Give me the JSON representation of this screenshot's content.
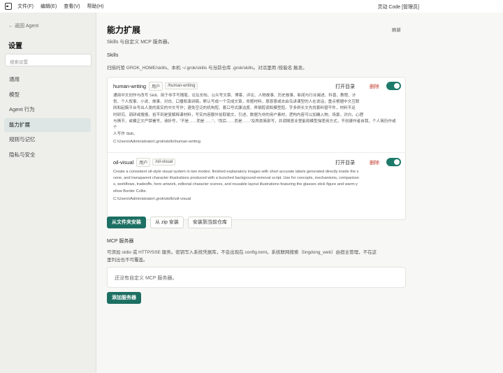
{
  "titlebar": {
    "menus": [
      "文件(F)",
      "编辑(E)",
      "查看(V)",
      "帮助(H)"
    ],
    "window_title": "灵动 Code [管理员]"
  },
  "sidebar": {
    "back": "← 返回 Agent",
    "title": "设置",
    "search_placeholder": "搜索设置",
    "items": [
      {
        "label": "通用",
        "active": false
      },
      {
        "label": "模型",
        "active": false
      },
      {
        "label": "Agent 行为",
        "active": false
      },
      {
        "label": "能力扩展",
        "active": true
      },
      {
        "label": "规则与记忆",
        "active": false
      },
      {
        "label": "隐私与安全",
        "active": false
      }
    ]
  },
  "main": {
    "title": "能力扩展",
    "refresh": "刷新",
    "subtitle": "Skills 与自定义 MCP 服务器。",
    "skills_heading": "Skills",
    "skills_desc": "扫描托管 GROK_HOME/skills、本机 ~/.grok/skills 与当前仓库 .grok/skills。对话里用 /技能名 触发。",
    "skills": [
      {
        "name": "human-writing",
        "tag_user": "用户",
        "tag_cmd": "/human-writing",
        "open": "打开目录",
        "delete": "删除",
        "enabled": true,
        "lines": [
          "通用中文创作与改写 Skill。用于非手写随笔、论坛长帖、公众号文章、博客、评论、人物故事、历史故事、新闻与行业阐述、科普、教程、计",
          "划、个人叙事、小说、故事、对白、口播和演讲稿，默认写成一个完成文章，命题材料，恩恩恩或去由鸟讲课型的人在说话，重点根据中文互联",
          "网和起稿平台写出人类的真实的中文写作；避免空泛的机构腔、套口号式廉洁度、弄钢腔调和模型腔。字多例长文先找套料替干件，材料不足",
          "时研究、调研或搜报，拾不到是复解释课材料，写实内容额外拾取输文，引述，数据为非的用户素材，逻构内容可以加确入物，场景，对白，心理",
          "与情节，或模正文严禁署号，请折号，“不是……而是……”，“而后……而是……”及两类简部写，并调随意业里能和模型描差用方式，不创建作者自我，个人简历作或个",
          "人写作 Skill。"
        ],
        "path": "C:\\Users\\Administrator\\.grok\\skills\\human-writing"
      },
      {
        "name": "oil-visual",
        "tag_user": "用户",
        "tag_cmd": "/oil-visual",
        "open": "打开目录",
        "delete": "删除",
        "enabled": true,
        "lines": [
          "Create a consistent oil-style visual system in two modes: finished explanatory images with short accurate labels generated directly inside the s",
          "cene, and transparent character illustrations produced with a bunched background-removal script. Use for concepts, mechanisms, comparison",
          "s, workflows, tradeoffs, hero artwork, editorial character scenes, and reusable layout illustrations featuring the glasses stick figure and warm-y",
          "ellow Border Collie."
        ],
        "path": "C:\\Users\\Administrator\\.grok\\skills\\oil-visual"
      }
    ],
    "buttons": {
      "install_folder": "从文件夹安装",
      "install_zip": "从 zip 安装",
      "install_repo": "安装到当前仓库"
    },
    "mcp_heading": "MCP 服务器",
    "mcp_desc_1": "可添加 stdio 或 HTTP/SSE 服务。密钥写入系统凭据库，不会出现在 config.toml。系统联网搜索（lingdong_web）由宿主管理，不在这",
    "mcp_desc_2": "里列出也不可覆盖。",
    "mcp_empty": "还没有自定义 MCP 服务器。",
    "add_server": "添加服务器"
  },
  "colors": {
    "accent": "#1c6f62",
    "toggle_on": "#1c7a6a",
    "danger": "#c0392b",
    "active_nav": "#dde6e4"
  }
}
